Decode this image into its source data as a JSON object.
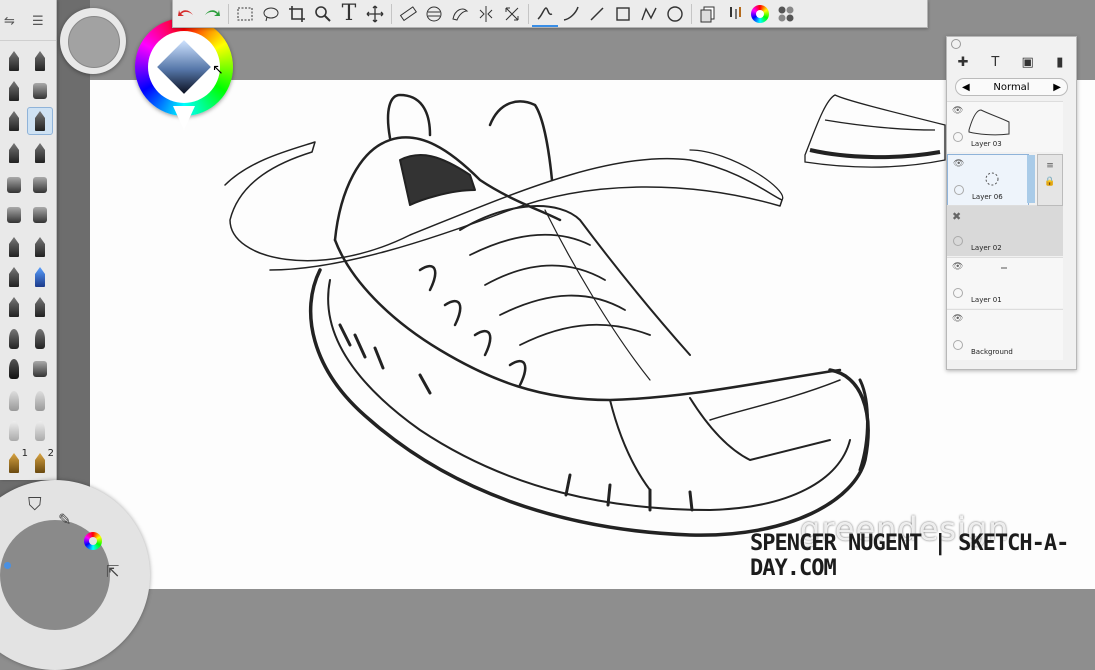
{
  "toolbar": {
    "tools": [
      "undo-icon",
      "redo-icon",
      "rect-select-icon",
      "lasso-icon",
      "crop-icon",
      "zoom-icon",
      "text-icon",
      "move-icon",
      "ruler-icon",
      "ellipse-guide-icon",
      "french-curve-icon",
      "symmetry-icon",
      "distort-icon",
      "stroke-icon",
      "curve-icon",
      "line-icon",
      "rectangle-icon",
      "polyline-icon",
      "circle-icon",
      "copy-icon",
      "brushes-icon",
      "color-wheel-icon",
      "swatches-icon"
    ],
    "text_tool_label": "T"
  },
  "brushes": {
    "numbers": [
      "1",
      "2"
    ]
  },
  "layers": {
    "blend_mode": "Normal",
    "items": [
      {
        "name": "Layer 03"
      },
      {
        "name": "Layer 06"
      },
      {
        "name": "Layer 02"
      },
      {
        "name": "Layer 01"
      },
      {
        "name": "Background"
      }
    ],
    "header_icons": [
      "add-layer-icon",
      "text-layer-icon",
      "image-layer-icon",
      "delete-layer-icon"
    ],
    "text_icon_label": "T"
  },
  "watermark": {
    "credit": "SPENCER NUGENT | SKETCH-A-DAY.COM",
    "overlay": "greendesign"
  },
  "colors": {
    "accent": "#3a8ee6",
    "canvas": "#fdfdfd",
    "panel": "#ececec"
  }
}
